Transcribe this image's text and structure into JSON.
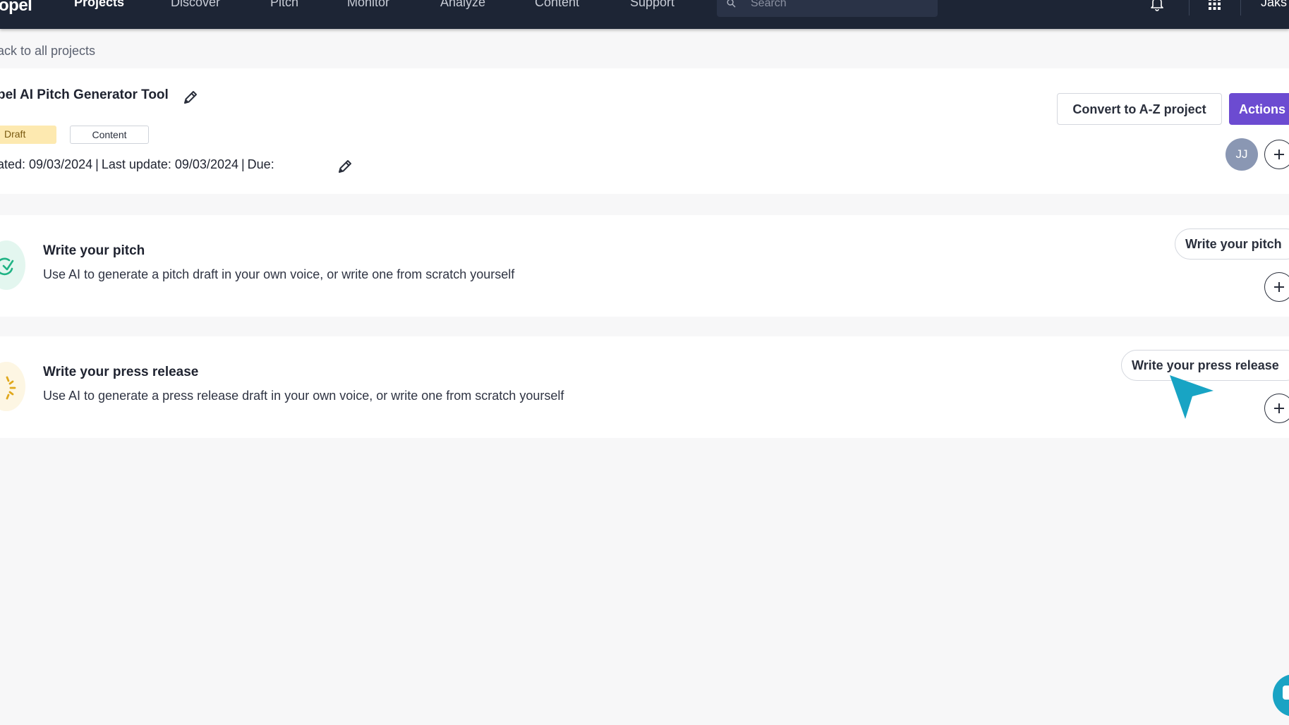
{
  "nav": {
    "logo": "opel",
    "items": [
      "Projects",
      "Discover",
      "Pitch",
      "Monitor",
      "Analyze",
      "Content",
      "Support"
    ],
    "active": "Projects",
    "search_placeholder": "Search",
    "user_name": "Jaks"
  },
  "back_link": "ack to all projects",
  "project": {
    "title": "pel AI Pitch Generator Tool",
    "status_tag": "Draft",
    "type_tag": "Content",
    "created_label": "ated: 09/03/2024",
    "updated_label": "Last update: 09/03/2024",
    "due_label": "Due:",
    "convert_button": "Convert to A-Z project",
    "actions_button": "Actions",
    "avatar_initials": "JJ"
  },
  "tasks": [
    {
      "title": "Write your pitch",
      "description": "Use AI to generate a pitch draft in your own voice, or write one from scratch yourself",
      "button": "Write your pitch",
      "icon": "check-circle-icon",
      "icon_color": "#1fb384"
    },
    {
      "title": "Write your press release",
      "description": "Use AI to generate a press release draft in your own voice, or write one from scratch yourself",
      "button": "Write your press release",
      "icon": "loading-spinner-icon",
      "icon_color": "#e0a81c"
    }
  ],
  "colors": {
    "nav_bg": "#1d2535",
    "accent": "#6c4bd1",
    "draft_tag_bg": "#fde9b0",
    "cursor": "#18a4c4"
  }
}
